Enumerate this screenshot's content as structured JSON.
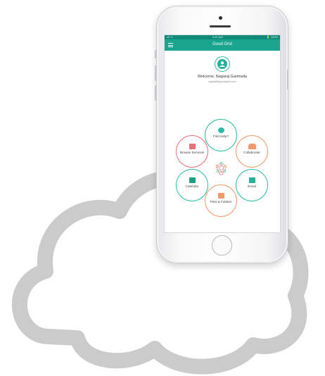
{
  "status_bar": {
    "carrier": "ııll ᯤ",
    "time": "9:41 AM",
    "battery": "🔋 100%"
  },
  "app": {
    "title": "Good Grid",
    "accent": "#19a58e"
  },
  "profile": {
    "welcome": "Welcome, Nagaraj Garimalla",
    "email": "ngaraj@goodgrid.com"
  },
  "menu_items": [
    {
      "label": "Find Help?",
      "color": "#2cbca3",
      "icon": "lifebuoy-icon"
    },
    {
      "label": "Browse Services",
      "color": "#e8707a",
      "icon": "book-icon"
    },
    {
      "label": "Collaborate",
      "color": "#f29a6b",
      "icon": "people-icon"
    },
    {
      "label": "Calendar",
      "color": "#2cbca3",
      "icon": "calendar-icon"
    },
    {
      "label": "Email",
      "color": "#2cbca3",
      "icon": "envelope-icon"
    },
    {
      "label": "Files & Folders",
      "color": "#f29a6b",
      "icon": "folder-icon"
    }
  ]
}
